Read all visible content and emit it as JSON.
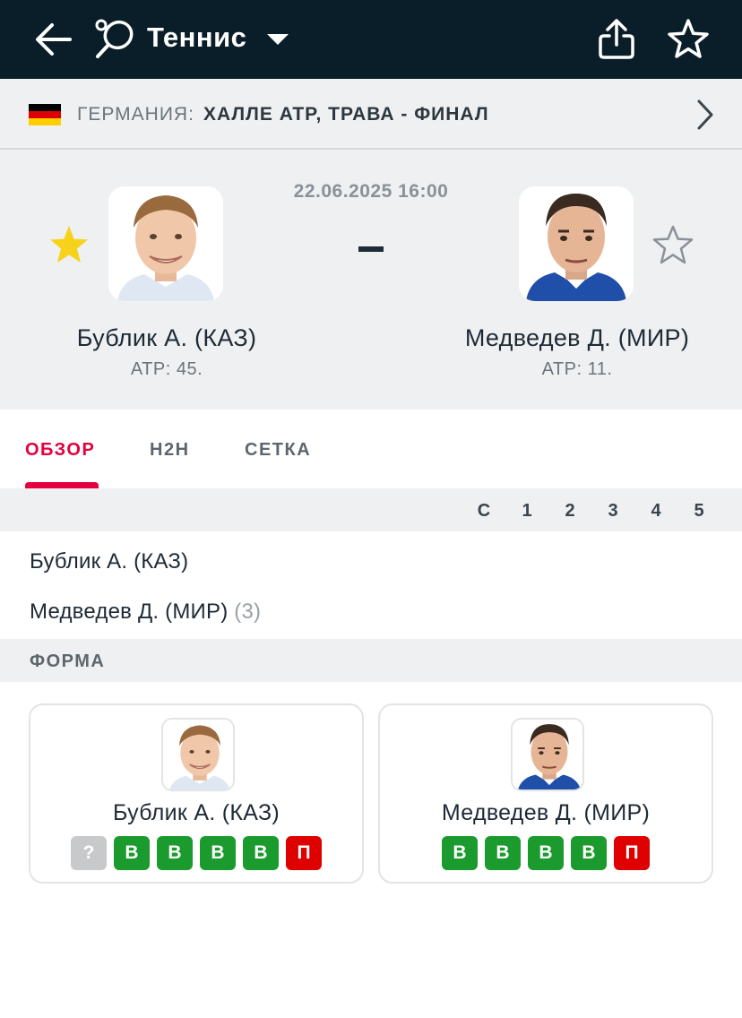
{
  "header": {
    "sport_title": "Теннис",
    "icons": [
      "back-arrow-icon",
      "tennis-racket-icon",
      "caret-down-icon",
      "share-icon",
      "star-outline-icon"
    ]
  },
  "league": {
    "country": "ГЕРМАНИЯ:",
    "tournament": "ХАЛЛЕ ATP, ТРАВА - ФИНАЛ",
    "flag": "germany-flag-icon"
  },
  "match": {
    "datetime": "22.06.2025 16:00",
    "home": {
      "name": "Бублик А. (КАЗ)",
      "rank": "ATP: 45.",
      "favorite": true
    },
    "away": {
      "name": "Медведев Д. (МИР)",
      "rank": "ATP: 11.",
      "favorite": false
    }
  },
  "tabs": [
    {
      "label": "ОБЗОР",
      "active": true
    },
    {
      "label": "H2H",
      "active": false
    },
    {
      "label": "СЕТКА",
      "active": false
    }
  ],
  "score": {
    "columns": [
      "С",
      "1",
      "2",
      "3",
      "4",
      "5"
    ],
    "rows": [
      {
        "name": "Бублик А. (КАЗ)",
        "seed": ""
      },
      {
        "name": "Медведев Д. (МИР)",
        "seed": "(3)"
      }
    ]
  },
  "form": {
    "label": "ФОРМА",
    "home": {
      "name": "Бублик А. (КАЗ)",
      "results": [
        "?",
        "В",
        "В",
        "В",
        "В",
        "П"
      ]
    },
    "away": {
      "name": "Медведев Д. (МИР)",
      "results": [
        "В",
        "В",
        "В",
        "В",
        "П"
      ]
    }
  },
  "colors": {
    "topbar": "#0a1e29",
    "accent": "#e4003f",
    "win": "#1b9a2e",
    "loss": "#df0000",
    "unknown": "#c7c9cb",
    "favorite_star": "#f7d21b"
  }
}
